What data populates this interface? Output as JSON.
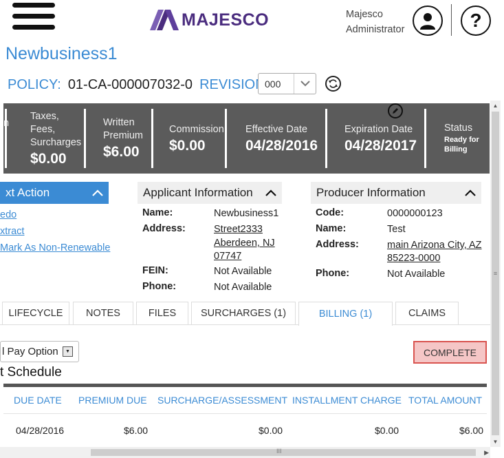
{
  "header": {
    "logo_text": "MAJESCO",
    "user_line1": "Majesco",
    "user_line2": "Administrator",
    "help_symbol": "?",
    "icons": [
      "menu-icon",
      "user-icon",
      "help-icon",
      "refresh-icon",
      "pencil-icon"
    ],
    "colors": {
      "accent": "#3b8bd4",
      "logo": "#4b2d7f",
      "bar": "#5b5b5b"
    }
  },
  "page": {
    "title": "Newbusiness1",
    "policy_label": "POLICY:",
    "policy_number": "01-CA-000007032-0",
    "revision_label": "REVISION:",
    "revision_value": "000"
  },
  "summary": {
    "partial": "n",
    "taxes_label_1": "Taxes,",
    "taxes_label_2": "Fees,",
    "taxes_label_3": "Surcharges",
    "taxes_value": "$0.00",
    "written_label_1": "Written",
    "written_label_2": "Premium",
    "written_value": "$6.00",
    "commission_label": "Commission",
    "commission_value": "$0.00",
    "effective_label": "Effective Date",
    "effective_value": "04/28/2016",
    "expiration_label": "Expiration Date",
    "expiration_value": "04/28/2017",
    "status_label": "Status",
    "status_value_1": "Ready for",
    "status_value_2": "Billing"
  },
  "next_action": {
    "title": "xt Action",
    "links": [
      "edo",
      "xtract",
      "Mark As Non-Renewable"
    ]
  },
  "applicant": {
    "title": "Applicant Information",
    "name_label": "Name:",
    "name_value": "Newbusiness1",
    "address_label": "Address:",
    "address_line1": "Street2333",
    "address_line2": "Aberdeen, NJ",
    "address_line3": "07747",
    "fein_label": "FEIN:",
    "fein_value": "Not Available",
    "phone_label": "Phone:",
    "phone_value": "Not Available"
  },
  "producer": {
    "title": "Producer Information",
    "code_label": "Code:",
    "code_value": "0000000123",
    "name_label": "Name:",
    "name_value": "Test",
    "address_label": "Address:",
    "address_line1": "main Arizona City, AZ",
    "address_line2": "85223-0000",
    "phone_label": "Phone:",
    "phone_value": "Not Available"
  },
  "tabs": {
    "lifecycle": "LIFECYCLE",
    "notes": "NOTES",
    "files": "FILES",
    "surcharges": "SURCHARGES (1)",
    "billing": "BILLING (1)",
    "claims": "CLAIMS",
    "active": "billing"
  },
  "billing": {
    "pay_option": "l Pay Option",
    "complete_label": "COMPLETE",
    "schedule_title": "t Schedule",
    "columns": [
      "DUE DATE",
      "PREMIUM DUE",
      "SURCHARGE/ASSESSMENT",
      "INSTALLMENT CHARGE",
      "TOTAL AMOUNT"
    ],
    "rows": [
      [
        "04/28/2016",
        "$6.00",
        "$0.00",
        "$0.00",
        "$6.00"
      ]
    ]
  },
  "scroll": {
    "h_grip": "III",
    "v_grip": "≡"
  }
}
